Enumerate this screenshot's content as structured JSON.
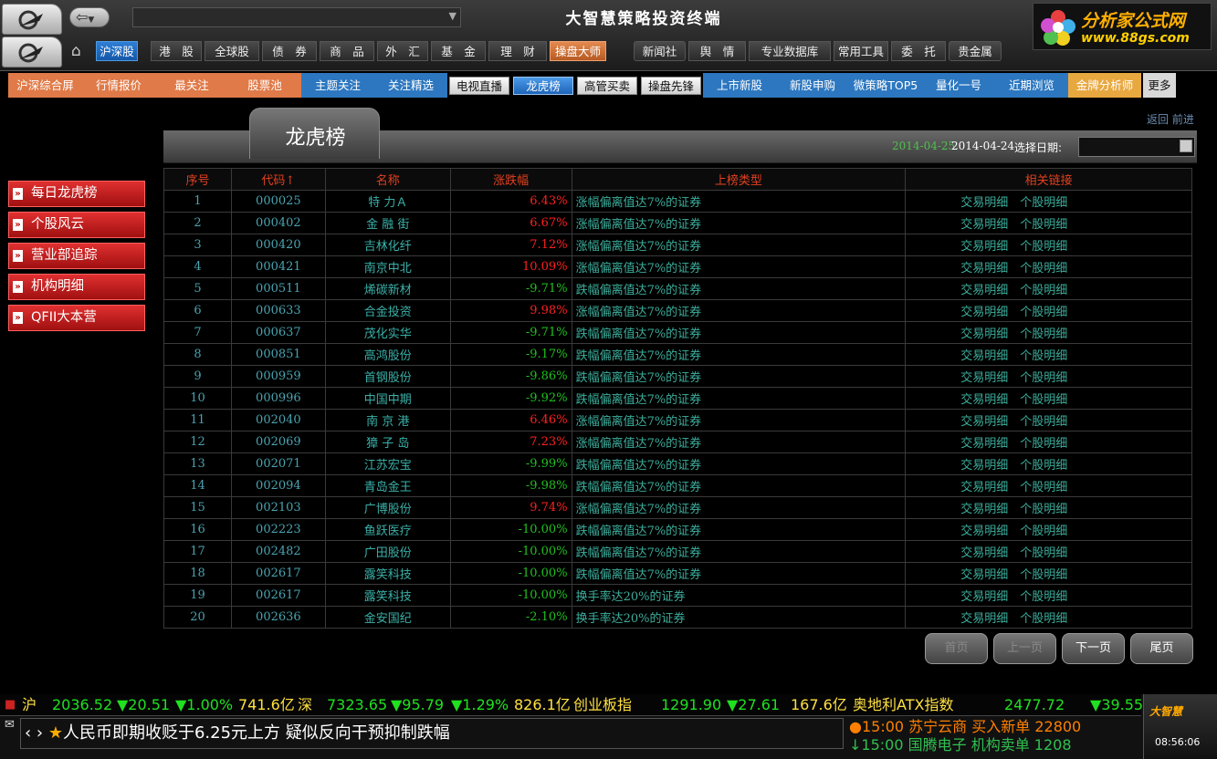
{
  "app": {
    "title": "大智慧策略投资终端",
    "brand_name": "分析家公式网",
    "brand_url": "www.88gs.com"
  },
  "toolbar": {
    "items": [
      "沪深股",
      "港　股",
      "全球股",
      "债　券",
      "商　品",
      "外　汇",
      "基　金",
      "理　财",
      "操盘大师"
    ],
    "right_items": [
      "新闻社",
      "舆　情",
      "专业数据库",
      "常用工具",
      "委　托",
      "贵金属"
    ]
  },
  "subnav": {
    "items": [
      "沪深综合屏",
      "行情报价",
      "最关注",
      "股票池",
      "主题关注",
      "关注精选",
      "电视直播",
      "龙虎榜",
      "高管买卖",
      "操盘先锋",
      "上市新股",
      "新股申购",
      "微策略TOP5",
      "量化一号",
      "近期浏览",
      "金牌分析师",
      "更多"
    ]
  },
  "page": {
    "title": "龙虎榜",
    "back_forward": "返回 前进",
    "date1": "2014-04-25",
    "date2": "2014-04-24",
    "date_label": "选择日期:"
  },
  "leftmenu": [
    "每日龙虎榜",
    "个股风云",
    "营业部追踪",
    "机构明细",
    "QFII大本营"
  ],
  "table": {
    "headers": [
      "序号",
      "代码↑",
      "名称",
      "涨跌幅",
      "上榜类型",
      "相关链接"
    ],
    "link1": "交易明细",
    "link2": "个股明细",
    "rows": [
      {
        "no": "1",
        "code": "000025",
        "name": "特 力Ａ",
        "chg": "6.43%",
        "dir": "up",
        "type": "涨幅偏离值达7%的证券"
      },
      {
        "no": "2",
        "code": "000402",
        "name": "金 融 街",
        "chg": "6.67%",
        "dir": "up",
        "type": "涨幅偏离值达7%的证券"
      },
      {
        "no": "3",
        "code": "000420",
        "name": "吉林化纤",
        "chg": "7.12%",
        "dir": "up",
        "type": "涨幅偏离值达7%的证券"
      },
      {
        "no": "4",
        "code": "000421",
        "name": "南京中北",
        "chg": "10.09%",
        "dir": "up",
        "type": "涨幅偏离值达7%的证券"
      },
      {
        "no": "5",
        "code": "000511",
        "name": "烯碳新材",
        "chg": "-9.71%",
        "dir": "dn",
        "type": "跌幅偏离值达7%的证券"
      },
      {
        "no": "6",
        "code": "000633",
        "name": "合金投资",
        "chg": "9.98%",
        "dir": "up",
        "type": "涨幅偏离值达7%的证券"
      },
      {
        "no": "7",
        "code": "000637",
        "name": "茂化实华",
        "chg": "-9.71%",
        "dir": "dn",
        "type": "跌幅偏离值达7%的证券"
      },
      {
        "no": "8",
        "code": "000851",
        "name": "高鸿股份",
        "chg": "-9.17%",
        "dir": "dn",
        "type": "跌幅偏离值达7%的证券"
      },
      {
        "no": "9",
        "code": "000959",
        "name": "首钢股份",
        "chg": "-9.86%",
        "dir": "dn",
        "type": "跌幅偏离值达7%的证券"
      },
      {
        "no": "10",
        "code": "000996",
        "name": "中国中期",
        "chg": "-9.92%",
        "dir": "dn",
        "type": "跌幅偏离值达7%的证券"
      },
      {
        "no": "11",
        "code": "002040",
        "name": "南 京 港",
        "chg": "6.46%",
        "dir": "up",
        "type": "涨幅偏离值达7%的证券"
      },
      {
        "no": "12",
        "code": "002069",
        "name": "獐 子 岛",
        "chg": "7.23%",
        "dir": "up",
        "type": "涨幅偏离值达7%的证券"
      },
      {
        "no": "13",
        "code": "002071",
        "name": "江苏宏宝",
        "chg": "-9.99%",
        "dir": "dn",
        "type": "跌幅偏离值达7%的证券"
      },
      {
        "no": "14",
        "code": "002094",
        "name": "青岛金王",
        "chg": "-9.98%",
        "dir": "dn",
        "type": "跌幅偏离值达7%的证券"
      },
      {
        "no": "15",
        "code": "002103",
        "name": "广博股份",
        "chg": "9.74%",
        "dir": "up",
        "type": "涨幅偏离值达7%的证券"
      },
      {
        "no": "16",
        "code": "002223",
        "name": "鱼跃医疗",
        "chg": "-10.00%",
        "dir": "dn",
        "type": "跌幅偏离值达7%的证券"
      },
      {
        "no": "17",
        "code": "002482",
        "name": "广田股份",
        "chg": "-10.00%",
        "dir": "dn",
        "type": "跌幅偏离值达7%的证券"
      },
      {
        "no": "18",
        "code": "002617",
        "name": "露笑科技",
        "chg": "-10.00%",
        "dir": "dn",
        "type": "跌幅偏离值达7%的证券"
      },
      {
        "no": "19",
        "code": "002617",
        "name": "露笑科技",
        "chg": "-10.00%",
        "dir": "dn",
        "type": "换手率达20%的证券"
      },
      {
        "no": "20",
        "code": "002636",
        "name": "金安国纪",
        "chg": "-2.10%",
        "dir": "dn",
        "type": "换手率达20%的证券"
      }
    ]
  },
  "pager": {
    "first": "首页",
    "prev": "上一页",
    "next": "下一页",
    "last": "尾页"
  },
  "ticker": {
    "sh_label": "沪",
    "sh_val": "2036.52",
    "sh_chg": "▼20.51",
    "sh_pct": "▼1.00%",
    "sh_amt": "741.6亿",
    "sz_label": "深",
    "sz_val": "7323.65",
    "sz_chg": "▼95.79",
    "sz_pct": "▼1.29%",
    "sz_amt": "826.1亿",
    "cy_label": "创业板指",
    "cy_val": "1291.90",
    "cy_chg": "▼27.61",
    "cy_amt": "167.6亿",
    "atx_label": "奥地利ATX指数",
    "atx_val": "2477.72",
    "atx_chg": "▼39.55",
    "news": "人民币即期收贬于6.25元上方 疑似反向干预抑制跌幅",
    "deal1": "●15:00 苏宁云商 买入新单 22800",
    "deal2": "↓15:00 国腾电子 机构卖单 1208",
    "clock": "08:56:06",
    "mini_logo": "大智慧"
  }
}
